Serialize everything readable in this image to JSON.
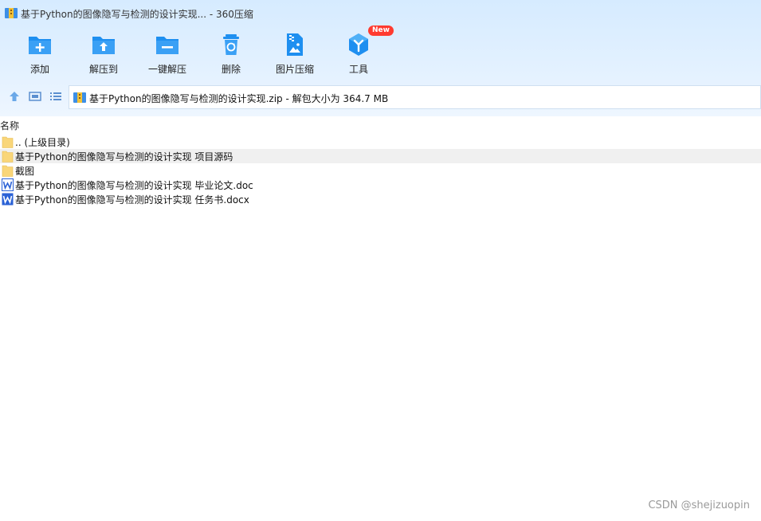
{
  "window": {
    "title": "基于Python的图像隐写与检测的设计实现... - 360压缩"
  },
  "toolbar": {
    "items": [
      {
        "label": "添加",
        "icon": "add-folder-icon"
      },
      {
        "label": "解压到",
        "icon": "extract-to-icon"
      },
      {
        "label": "一键解压",
        "icon": "one-click-extract-icon"
      },
      {
        "label": "删除",
        "icon": "delete-icon"
      },
      {
        "label": "图片压缩",
        "icon": "image-compress-icon"
      },
      {
        "label": "工具",
        "icon": "tools-icon",
        "badge": "New"
      }
    ]
  },
  "nav": {
    "path": "基于Python的图像隐写与检测的设计实现.zip - 解包大小为 364.7 MB"
  },
  "columns": {
    "name": "名称"
  },
  "files": [
    {
      "name": ".. (上级目录)",
      "type": "folder"
    },
    {
      "name": "基于Python的图像隐写与检测的设计实现 项目源码",
      "type": "folder",
      "selected": true
    },
    {
      "name": "截图",
      "type": "folder"
    },
    {
      "name": "基于Python的图像隐写与检测的设计实现 毕业论文.doc",
      "type": "doc"
    },
    {
      "name": "基于Python的图像隐写与检测的设计实现 任务书.docx",
      "type": "docx"
    }
  ],
  "watermark": "CSDN @shejizuopin",
  "colors": {
    "accent": "#1e8ff0",
    "folder": "#f9d67a",
    "word": "#2b62d6"
  }
}
